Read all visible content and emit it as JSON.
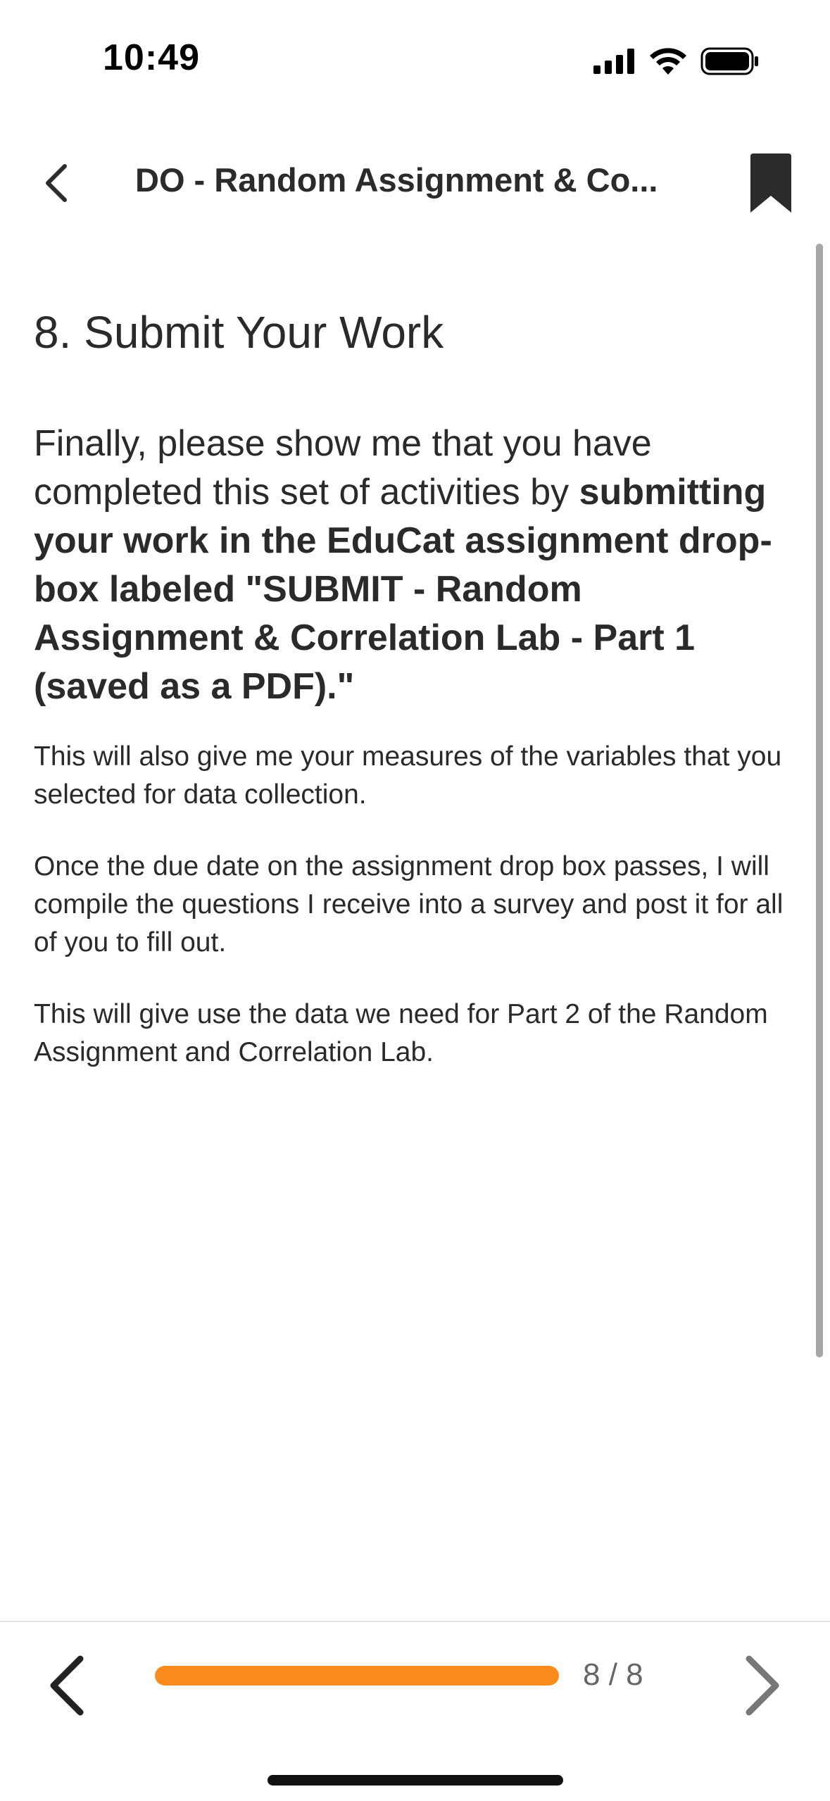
{
  "status_bar": {
    "time": "10:49",
    "icons": [
      "cellular-signal-icon",
      "wifi-icon",
      "battery-icon"
    ]
  },
  "header": {
    "title": "DO - Random Assignment & Co...",
    "back_icon": "chevron-left-icon",
    "bookmark_icon": "bookmark-icon"
  },
  "content": {
    "title": "8. Submit Your Work",
    "intro_plain": "Finally, please show me that you have completed this set of activities by ",
    "intro_bold": "submitting your work in the EduCat assignment drop-box labeled \"SUBMIT - Random Assignment & Correlation Lab - Part 1 (saved as a PDF).\"",
    "paragraphs": [
      "This will also give me your measures of the variables that you selected for data collection.",
      "Once the due date on the assignment drop box passes, I will compile the questions I receive into a survey and post it for all of you to fill out.",
      "This will give use the data we need for Part 2 of the Random Assignment and Correlation Lab."
    ]
  },
  "footer": {
    "prev_icon": "chevron-left-icon",
    "next_icon": "chevron-right-icon",
    "page_counter": "8 / 8",
    "progress": 1.0,
    "accent_color": "#fb8b1a"
  }
}
